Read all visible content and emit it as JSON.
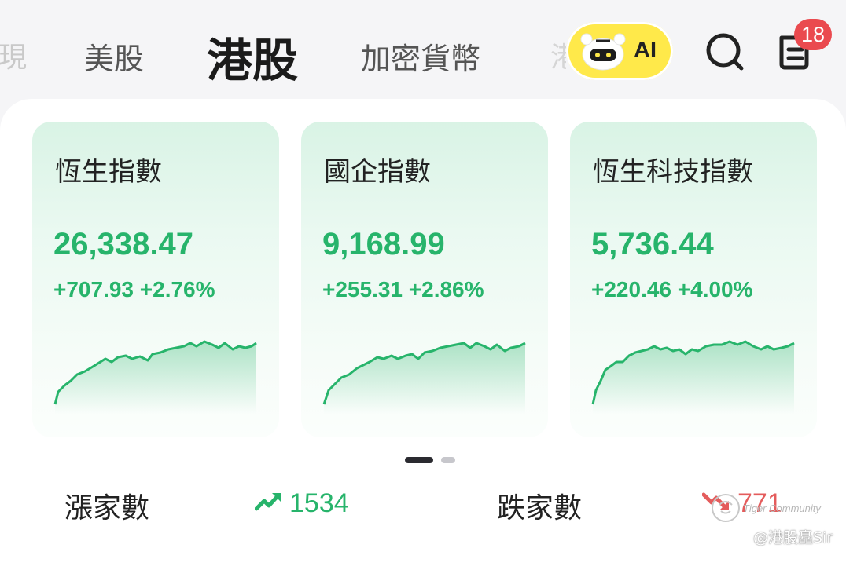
{
  "tabs": {
    "cut_left": "現",
    "us": "美股",
    "hk": "港股",
    "crypto": "加密貨幣",
    "cut_right": "港"
  },
  "header": {
    "ai_label": "AI",
    "notification_count": "18"
  },
  "cards": [
    {
      "name": "恆生指數",
      "price": "26,338.47",
      "change": "+707.93 +2.76%"
    },
    {
      "name": "國企指數",
      "price": "9,168.99",
      "change": "+255.31 +2.86%"
    },
    {
      "name": "恆生科技指數",
      "price": "5,736.44",
      "change": "+220.46 +4.00%"
    }
  ],
  "pager": {
    "pages": 2,
    "current": 1
  },
  "breadth": {
    "advance_label": "漲家數",
    "advance_count": "1534",
    "decline_label": "跌家數",
    "decline_count": "771"
  },
  "watermark": {
    "brand": "Tiger Community",
    "author": "@港股矗Sir"
  },
  "colors": {
    "up": "#27b46b",
    "down": "#e45c5c",
    "ai_pill": "#ffe94a",
    "badge": "#ea4a4f"
  }
}
